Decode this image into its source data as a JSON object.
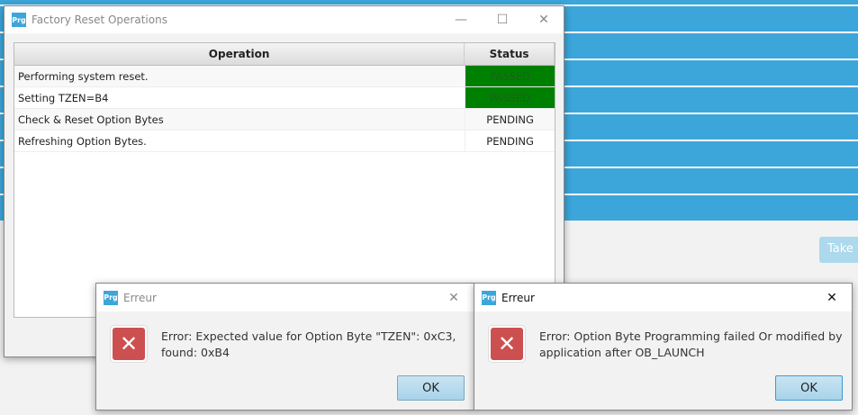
{
  "background": {
    "take_button": "Take C"
  },
  "main_dialog": {
    "title": "Factory Reset Operations",
    "columns": [
      "Operation",
      "Status"
    ],
    "rows": [
      {
        "operation": "Performing system reset.",
        "status": "PASSED"
      },
      {
        "operation": "Setting TZEN=B4",
        "status": "PASSED"
      },
      {
        "operation": "Check & Reset Option Bytes",
        "status": "PENDING"
      },
      {
        "operation": "Refreshing Option Bytes.",
        "status": "PENDING"
      }
    ]
  },
  "error_dialogs": [
    {
      "title": "Erreur",
      "message": "Error: Expected value for Option Byte \"TZEN\": 0xC3, found: 0xB4",
      "ok": "OK"
    },
    {
      "title": "Erreur",
      "message": "Error: Option Byte Programming failed Or modified by application after OB_LAUNCH",
      "ok": "OK"
    }
  ],
  "app_icon_text": "Prg",
  "colors": {
    "passed": "#008000",
    "accent": "#3ca6da"
  }
}
